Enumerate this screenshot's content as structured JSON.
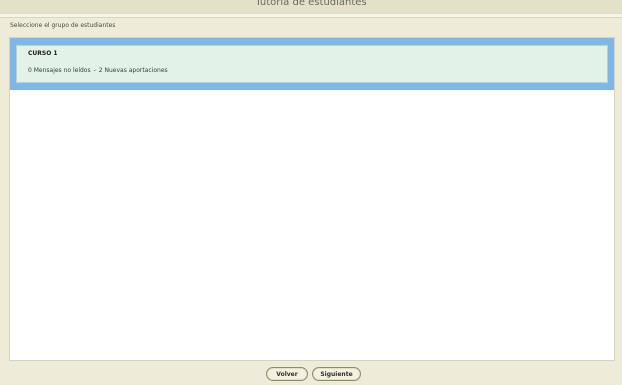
{
  "window": {
    "title": "Tutoría de estudiantes"
  },
  "instruction": "Seleccione el grupo de estudiantes",
  "groups": [
    {
      "name": "CURSO 1",
      "unread_messages": "0 Mensajes no leídos",
      "separator": "-",
      "new_contributions": "2 Nuevas aportaciones"
    }
  ],
  "footer": {
    "back_label": "Volver",
    "next_label": "Siguiente"
  },
  "colors": {
    "background": "#eeecd9",
    "selected_card_border": "#7fb7e8",
    "card_fill": "#e3f2e8"
  }
}
